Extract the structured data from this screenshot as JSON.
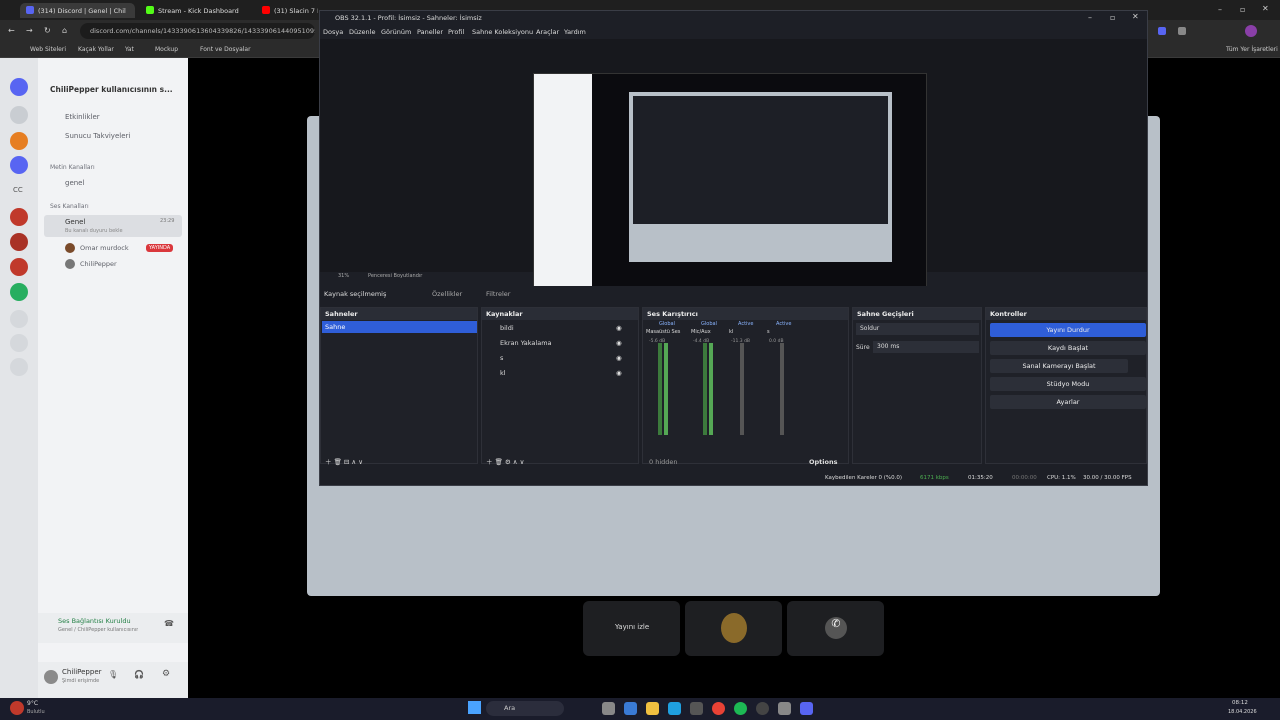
{
  "browser": {
    "tabs": [
      "(314) Discord | Genel | Chil",
      "Stream - Kick Dashboard",
      "(31) Slacin 7 Full F"
    ],
    "url": "discord.com/channels/1433390613604339826/1433390614409510955",
    "bookmarks": [
      "Web Siteleri",
      "Kaçak Yollar",
      "Yat",
      "Mockup",
      "Font ve Dosyalar"
    ],
    "bookmark_right": "Tüm Yer İşaretleri"
  },
  "discord": {
    "server_name": "ChiliPepper kullanıcısının s...",
    "events": "Etkinlikler",
    "boosts": "Sunucu Takviyeleri",
    "text_category": "Metin Kanalları",
    "text_channel": "genel",
    "voice_category": "Ses Kanalları",
    "voice_channel": "Genel",
    "voice_count": "23:29",
    "voice_sub": "Bu kanalı duyuru bekle",
    "user1": "Omar murdock",
    "live_badge": "YAYINDA",
    "user2": "ChiliPepper",
    "voice_status": "Ses Bağlantısı Kuruldu",
    "voice_status_sub": "Genel / ChiliPepper kullanıcısının sunu...",
    "me_name": "ChiliPepper",
    "me_status": "Şimdi erişimde",
    "watch_btn": "Yayını izle",
    "cc": "CC"
  },
  "obs": {
    "title": "OBS 32.1.1 - Profil: İsimsiz - Sahneler: İsimsiz",
    "menu": [
      "Dosya",
      "Düzenle",
      "Görünüm",
      "Paneller",
      "Profil",
      "Sahne Koleksiyonu",
      "Araçlar",
      "Yardım"
    ],
    "no_source": "Kaynak seçilmemiş",
    "properties": "Özellikler",
    "filters": "Filtreler",
    "zoom": "31%",
    "preview_label": "Penceresi Boyutlandır",
    "scenes_title": "Sahneler",
    "scene_1": "Sahne",
    "sources_title": "Kaynaklar",
    "sources": [
      "bildi",
      "Ekran Yakalama",
      "s",
      "kl"
    ],
    "mixer_title": "Ses Karıştırıcı",
    "mixer_tabs": [
      "Global",
      "Global",
      "Active",
      "Active"
    ],
    "mixer_channels": [
      "Masaüstü Ses",
      "Mic/Aux",
      "kl",
      "s"
    ],
    "mixer_db": [
      "-5.6 dB",
      "-4.4 dB",
      "-11.3 dB",
      "0.0 dB"
    ],
    "hidden": "0 hidden",
    "options": "Options",
    "transitions_title": "Sahne Geçişleri",
    "transition": "Soldur",
    "duration_label": "Süre",
    "duration": "300 ms",
    "controls_title": "Kontroller",
    "controls": [
      "Yayını Durdur",
      "Kaydı Başlat",
      "Sanal Kamerayı Başlat",
      "Stüdyo Modu",
      "Ayarlar"
    ],
    "status_dropped": "Kaybedilen Kareler 0 (%0.0)",
    "status_kbps": "6171 kbps",
    "status_time": "01:35:20",
    "status_rec": "00:00:00",
    "status_cpu": "CPU: 1.1%",
    "status_fps": "30.00 / 30.00 FPS"
  },
  "taskbar": {
    "search": "Ara",
    "weather": "9°C",
    "weather_sub": "Bulutlu",
    "time": "08:12",
    "date": "18.04.2026"
  }
}
